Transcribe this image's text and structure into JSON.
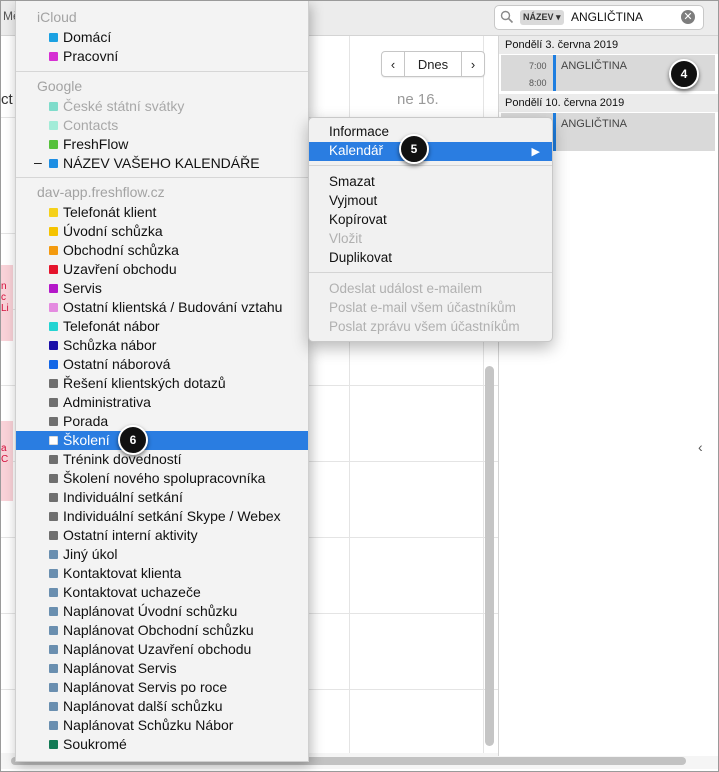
{
  "toolbar": {
    "left_cut_label": "Mě",
    "prev_label": "‹",
    "today_label": "Dnes",
    "next_label": "›"
  },
  "calendar_view": {
    "day_header": "ne 16.",
    "left_partial_text": "ct",
    "pink_event_1": "n c Li",
    "pink_event_2": "a C"
  },
  "search": {
    "icon": "magnifier-icon",
    "token_label": "NÁZEV ▾",
    "term": "ANGLIČTINA",
    "clear_icon": "clear-icon"
  },
  "results": {
    "groups": [
      {
        "header": "Pondělí 3. června 2019",
        "time_start": "7:00",
        "time_end": "8:00",
        "title": "ANGLIČTINA"
      },
      {
        "header": "Pondělí 10. června 2019",
        "time_start": "",
        "time_end": "",
        "title": "ANGLIČTINA"
      }
    ],
    "collapse_arrow": "‹"
  },
  "calendar_menu": {
    "sections": [
      {
        "name": "iCloud",
        "items": [
          {
            "label": "Domácí",
            "color": "#1ba1e2"
          },
          {
            "label": "Pracovní",
            "color": "#d62fd3"
          }
        ]
      },
      {
        "name": "Google",
        "items": [
          {
            "label": "České státní svátky",
            "color": "#7fdccb",
            "dim": true
          },
          {
            "label": "Contacts",
            "color": "#a3ecd8",
            "dim": true
          },
          {
            "label": "FreshFlow",
            "color": "#56c13c"
          },
          {
            "label": "NÁZEV VAŠEHO KALENDÁŘE",
            "color": "#1d8ee3",
            "dash": "–"
          }
        ]
      },
      {
        "name": "dav-app.freshflow.cz",
        "items": [
          {
            "label": "Telefonát klient",
            "color": "#f5d11b"
          },
          {
            "label": "Úvodní schůzka",
            "color": "#f5c300"
          },
          {
            "label": "Obchodní schůzka",
            "color": "#f39a0e"
          },
          {
            "label": "Uzavření obchodu",
            "color": "#e5142c"
          },
          {
            "label": "Servis",
            "color": "#b417c9"
          },
          {
            "label": "Ostatní klientská / Budování vztahu",
            "color": "#e48be0"
          },
          {
            "label": "Telefonát nábor",
            "color": "#23d4d2"
          },
          {
            "label": "Schůzka nábor",
            "color": "#1a0fa8"
          },
          {
            "label": "Ostatní náborová",
            "color": "#1366e6"
          },
          {
            "label": "Řešení klientských dotazů",
            "color": "#6f6f6f"
          },
          {
            "label": "Administrativa",
            "color": "#6f6f6f"
          },
          {
            "label": "Porada",
            "color": "#6f6f6f"
          },
          {
            "label": "Školení",
            "color": "#6f6f6f",
            "selected": true
          },
          {
            "label": "Trénink dovedností",
            "color": "#6f6f6f"
          },
          {
            "label": "Školení nového spolupracovníka",
            "color": "#6f6f6f"
          },
          {
            "label": "Individuální setkání",
            "color": "#6f6f6f"
          },
          {
            "label": "Individuální setkání Skype / Webex",
            "color": "#6f6f6f"
          },
          {
            "label": "Ostatní interní aktivity",
            "color": "#6f6f6f"
          },
          {
            "label": "Jiný úkol",
            "color": "#6a8fb0"
          },
          {
            "label": "Kontaktovat klienta",
            "color": "#6a8fb0"
          },
          {
            "label": "Kontaktovat uchazeče",
            "color": "#6a8fb0"
          },
          {
            "label": "Naplánovat Úvodní schůzku",
            "color": "#6a8fb0"
          },
          {
            "label": "Naplánovat Obchodní schůzku",
            "color": "#6a8fb0"
          },
          {
            "label": "Naplánovat Uzavření obchodu",
            "color": "#6a8fb0"
          },
          {
            "label": "Naplánovat Servis",
            "color": "#6a8fb0"
          },
          {
            "label": "Naplánovat Servis po roce",
            "color": "#6a8fb0"
          },
          {
            "label": "Naplánovat další schůzku",
            "color": "#6a8fb0"
          },
          {
            "label": "Naplánovat Schůzku Nábor",
            "color": "#6a8fb0"
          },
          {
            "label": "Soukromé",
            "color": "#137a55"
          }
        ]
      }
    ]
  },
  "context_menu": {
    "groups": [
      [
        {
          "label": "Informace"
        },
        {
          "label": "Kalendář",
          "selected": true,
          "submenu": "▶"
        }
      ],
      [
        {
          "label": "Smazat"
        },
        {
          "label": "Vyjmout"
        },
        {
          "label": "Kopírovat"
        },
        {
          "label": "Vložit",
          "disabled": true
        },
        {
          "label": "Duplikovat"
        }
      ],
      [
        {
          "label": "Odeslat událost e-mailem",
          "disabled": true
        },
        {
          "label": "Poslat e-mail všem účastníkům",
          "disabled": true
        },
        {
          "label": "Poslat zprávu všem účastníkům",
          "disabled": true
        }
      ]
    ]
  },
  "badges": {
    "results_badge": "4",
    "calendar_item_badge": "5",
    "skoleni_badge": "6"
  }
}
